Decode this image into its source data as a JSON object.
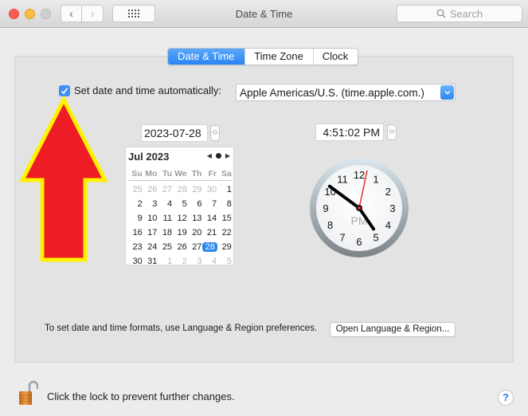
{
  "window": {
    "title": "Date & Time",
    "search_placeholder": "Search",
    "back_icon": "‹",
    "forward_icon": "›"
  },
  "tabs": [
    {
      "label": "Date & Time",
      "active": true
    },
    {
      "label": "Time Zone",
      "active": false
    },
    {
      "label": "Clock",
      "active": false
    }
  ],
  "auto": {
    "checked": true,
    "label": "Set date and time automatically:",
    "server": "Apple Americas/U.S. (time.apple.com.)"
  },
  "date_field": "2023-07-28",
  "time_field": "4:51:02 PM",
  "calendar": {
    "month_label": "Jul 2023",
    "weekdays": [
      "Su",
      "Mo",
      "Tu",
      "We",
      "Th",
      "Fr",
      "Sa"
    ],
    "weeks": [
      [
        {
          "d": "25",
          "dim": true
        },
        {
          "d": "26",
          "dim": true
        },
        {
          "d": "27",
          "dim": true
        },
        {
          "d": "28",
          "dim": true
        },
        {
          "d": "29",
          "dim": true
        },
        {
          "d": "30",
          "dim": true
        },
        {
          "d": "1"
        }
      ],
      [
        {
          "d": "2"
        },
        {
          "d": "3"
        },
        {
          "d": "4"
        },
        {
          "d": "5"
        },
        {
          "d": "6"
        },
        {
          "d": "7"
        },
        {
          "d": "8"
        }
      ],
      [
        {
          "d": "9"
        },
        {
          "d": "10"
        },
        {
          "d": "11"
        },
        {
          "d": "12"
        },
        {
          "d": "13"
        },
        {
          "d": "14"
        },
        {
          "d": "15"
        }
      ],
      [
        {
          "d": "16"
        },
        {
          "d": "17"
        },
        {
          "d": "18"
        },
        {
          "d": "19"
        },
        {
          "d": "20"
        },
        {
          "d": "21"
        },
        {
          "d": "22"
        }
      ],
      [
        {
          "d": "23"
        },
        {
          "d": "24"
        },
        {
          "d": "25"
        },
        {
          "d": "26"
        },
        {
          "d": "27"
        },
        {
          "d": "28",
          "selected": true
        },
        {
          "d": "29"
        }
      ],
      [
        {
          "d": "30"
        },
        {
          "d": "31"
        },
        {
          "d": "1",
          "dim": true
        },
        {
          "d": "2",
          "dim": true
        },
        {
          "d": "3",
          "dim": true
        },
        {
          "d": "4",
          "dim": true
        },
        {
          "d": "5",
          "dim": true
        }
      ]
    ]
  },
  "clock": {
    "numbers": [
      "12",
      "1",
      "2",
      "3",
      "4",
      "5",
      "6",
      "7",
      "8",
      "9",
      "10",
      "11"
    ],
    "meridiem": "PM",
    "hour": 4,
    "minute": 51,
    "second": 2
  },
  "formats_text": "To set date and time formats, use Language & Region preferences.",
  "open_language_button": "Open Language & Region...",
  "lock_text": "Click the lock to prevent further changes.",
  "help_label": "?",
  "colors": {
    "accent": "#2a84f5",
    "annotation_arrow_fill": "#ee1c25",
    "annotation_arrow_stroke": "#fff200"
  }
}
